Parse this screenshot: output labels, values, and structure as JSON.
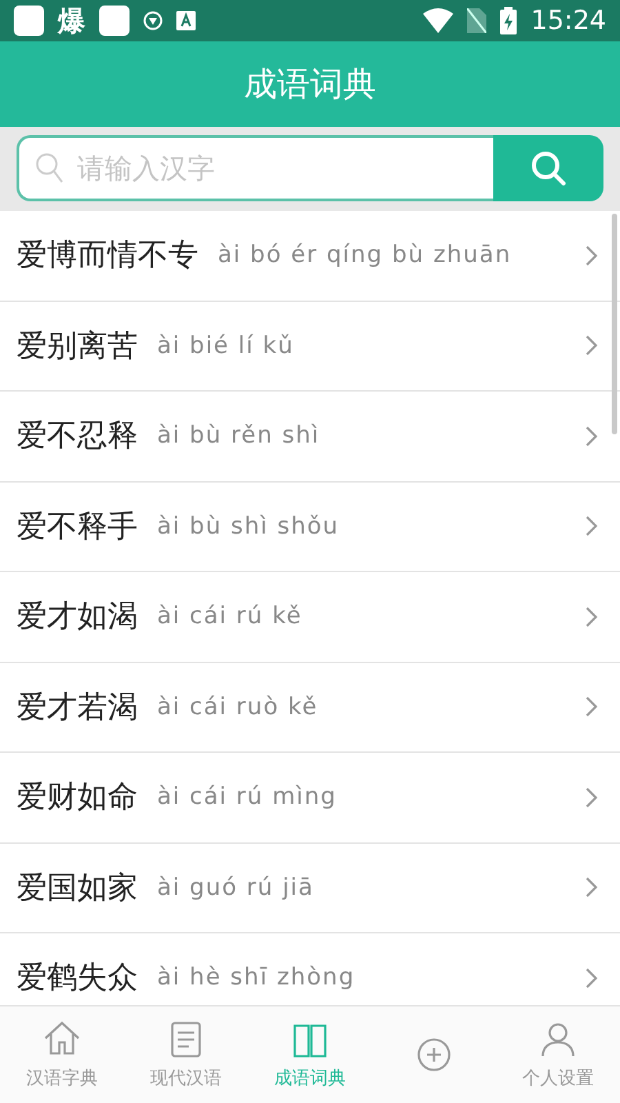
{
  "status_bar": {
    "app_label": "爆",
    "time": "15:24"
  },
  "title": "成语词典",
  "search": {
    "placeholder": "请输入汉字"
  },
  "idioms": [
    {
      "word": "爱博而情不专",
      "pinyin": "ài bó ér qíng bù zhuān"
    },
    {
      "word": "爱别离苦",
      "pinyin": "ài bié lí kǔ"
    },
    {
      "word": "爱不忍释",
      "pinyin": "ài bù rěn shì"
    },
    {
      "word": "爱不释手",
      "pinyin": "ài bù shì shǒu"
    },
    {
      "word": "爱才如渴",
      "pinyin": "ài cái rú kě"
    },
    {
      "word": "爱才若渴",
      "pinyin": "ài cái ruò kě"
    },
    {
      "word": "爱财如命",
      "pinyin": "ài cái rú mìng"
    },
    {
      "word": "爱国如家",
      "pinyin": "ài guó rú jiā"
    },
    {
      "word": "爱鹤失众",
      "pinyin": "ài hè shī zhòng"
    }
  ],
  "bottom_nav": [
    {
      "label": "汉语字典",
      "selected": false
    },
    {
      "label": "现代汉语",
      "selected": false
    },
    {
      "label": "成语词典",
      "selected": true
    },
    {
      "selected": false
    },
    {
      "label": "个人设置",
      "selected": false
    }
  ]
}
